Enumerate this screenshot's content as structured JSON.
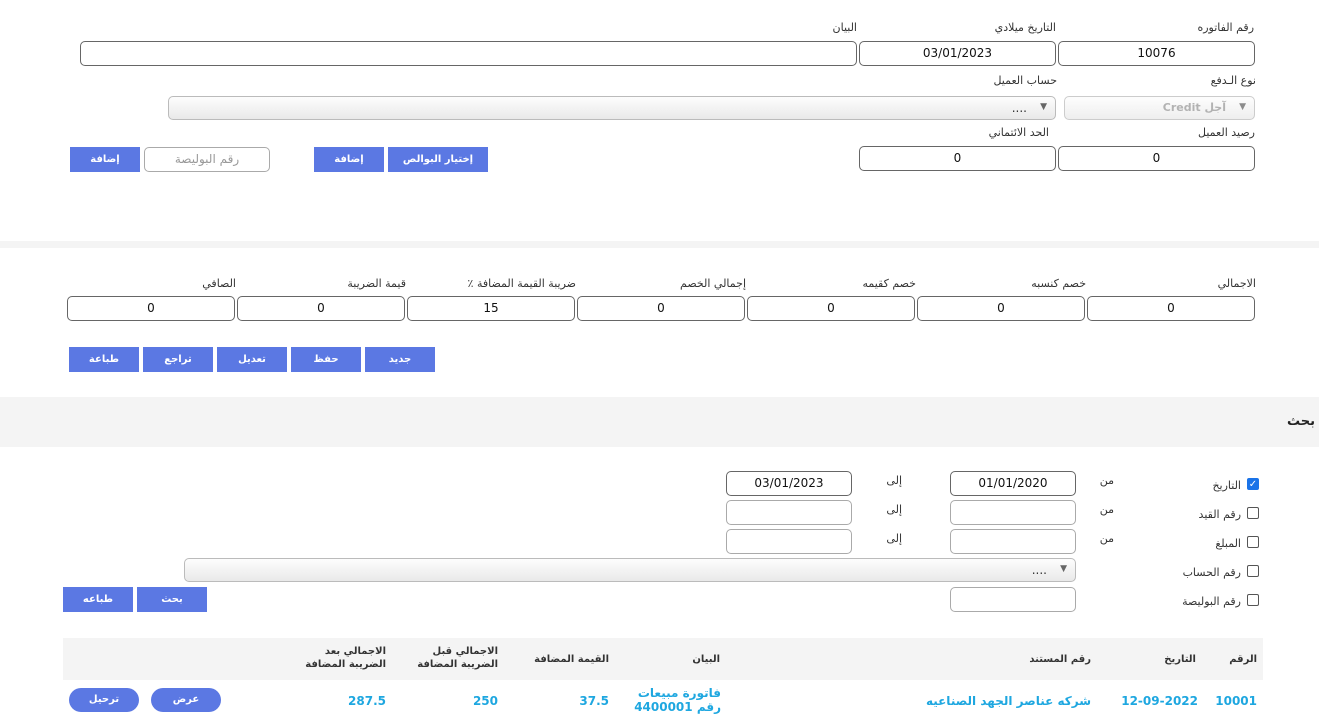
{
  "header": {
    "invoice_no_label": "رقم الفاتوره",
    "invoice_no": "10076",
    "date_label": "التاريخ ميلادي",
    "date": "03/01/2023",
    "statement_label": "البيان",
    "statement": "",
    "payment_type_label": "نوع الـدفع",
    "payment_type": "آجل Credit",
    "customer_account_label": "حساب العميل",
    "customer_account": "....",
    "customer_balance_label": "رصيد العميل",
    "customer_balance": "0",
    "credit_limit_label": "الحد الائتماني",
    "credit_limit": "0",
    "choose_policies_button": "إختيار البوالص",
    "add_button": "إضافة",
    "policy_no_placeholder": "رقم البوليصة",
    "add_button_2": "إضافة"
  },
  "totals": {
    "total_label": "الاجمالي",
    "total": "0",
    "pct_discount_label": "خصم كنسبه",
    "pct_discount": "0",
    "qty_discount_label": "خصم كقيمه",
    "qty_discount": "0",
    "total_discount_label": "إجمالي الخصم",
    "total_discount": "0",
    "vat_label": "ضريبة القيمة المضافة ٪",
    "vat": "15",
    "tax_value_label": "قيمة الضريبة",
    "tax_value": "0",
    "net_label": "الصافي",
    "net": "0"
  },
  "actions": {
    "new": "جديد",
    "save": "حفظ",
    "edit": "تعديل",
    "undo": "تراجع",
    "print": "طباعة"
  },
  "search": {
    "title": "بحث",
    "from_label": "من",
    "to_label": "إلى",
    "date_label": "التاريخ",
    "date_checked": true,
    "date_from": "01/01/2020",
    "date_to": "03/01/2023",
    "entry_no_label": "رقم القيد",
    "amount_label": "المبلغ",
    "account_no_label": "رقم الحساب",
    "account_select": "....",
    "policy_no_label": "رقم البوليصة",
    "search_button": "بحث",
    "print_button": "طباعه"
  },
  "table": {
    "headers": {
      "no": "الرقم",
      "date": "التاريخ",
      "doc_no": "رقم المستند",
      "statement": "البيان",
      "vat_value": "القيمة المضافة",
      "total_before_tax": "الاجمالي قبل الضريبة المضافة",
      "total_after_tax": "الاجمالي بعد الضريبة المضافة"
    },
    "rows": [
      {
        "no": "10001",
        "date": "12-09-2022",
        "doc_no": "شركه عناصر الجهد الصناعيه",
        "statement": "فاتورة مبيعات رقم 4400001",
        "vat_value": "37.5",
        "total_before_tax": "250",
        "total_after_tax": "287.5",
        "view_button": "عرض",
        "post_button": "ترحيل"
      }
    ]
  }
}
